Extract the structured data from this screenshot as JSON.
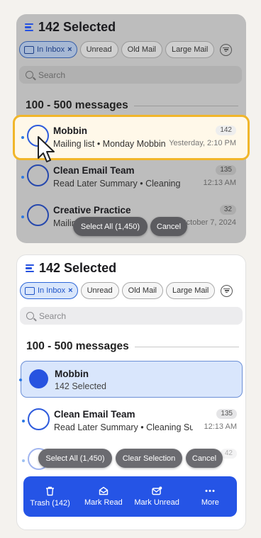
{
  "header": {
    "title": "142 Selected"
  },
  "filters": [
    {
      "label": "In Inbox",
      "active": true
    },
    {
      "label": "Unread",
      "active": false
    },
    {
      "label": "Old Mail",
      "active": false
    },
    {
      "label": "Large Mail",
      "active": false
    }
  ],
  "search": {
    "placeholder": "Search"
  },
  "section": {
    "label": "100 - 500 messages"
  },
  "top_card": {
    "rows": [
      {
        "sender": "Mobbin",
        "subject": "Mailing list • Monday Mobbin…",
        "count": "142",
        "time": "Yesterday, 2:10 PM"
      },
      {
        "sender": "Clean Email Team",
        "subject": "Read Later Summary • Cleaning Su…",
        "count": "135",
        "time": "12:13 AM"
      },
      {
        "sender": "Creative Practice",
        "subject": "Mailing",
        "count": "32",
        "time": "October 7, 2024"
      }
    ],
    "select_all": "Select All (1,450)",
    "cancel": "Cancel"
  },
  "bottom_card": {
    "selected_row": {
      "sender": "Mobbin",
      "subtitle": "142 Selected"
    },
    "rows": [
      {
        "sender": "Clean Email Team",
        "subject": "Read Later Summary • Cleaning Su…",
        "count": "135",
        "time": "12:13 AM"
      },
      {
        "count": "42"
      }
    ],
    "select_all": "Select All (1,450)",
    "clear_selection": "Clear Selection",
    "cancel": "Cancel",
    "actions": [
      {
        "label": "Trash (142)",
        "icon": "trash-icon"
      },
      {
        "label": "Mark Read",
        "icon": "envelope-open-icon"
      },
      {
        "label": "Mark Unread",
        "icon": "envelope-badge-icon"
      },
      {
        "label": "More",
        "icon": "more-icon"
      }
    ]
  },
  "colors": {
    "accent": "#2554e6",
    "highlight_border": "#f1b62a",
    "highlight_bg": "#fff8e9"
  }
}
